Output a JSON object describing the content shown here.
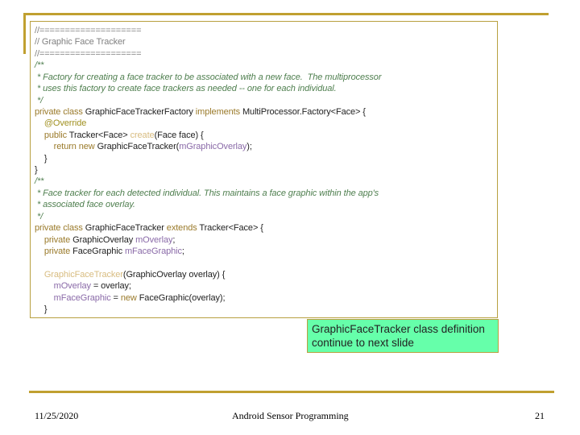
{
  "code_lines": [
    [
      [
        "c",
        "//===================="
      ]
    ],
    [
      [
        "c",
        "// Graphic Face Tracker"
      ]
    ],
    [
      [
        "c",
        "//===================="
      ]
    ],
    [
      [
        "cm",
        "/**"
      ]
    ],
    [
      [
        "cm",
        " * Factory for creating a face tracker to be associated with a new face.  The multiprocessor"
      ]
    ],
    [
      [
        "cm",
        " * uses this factory to create face trackers as needed -- one for each individual."
      ]
    ],
    [
      [
        "cm",
        " */"
      ]
    ],
    [
      [
        "k",
        "private class "
      ],
      [
        "p",
        "GraphicFaceTrackerFactory "
      ],
      [
        "k",
        "implements "
      ],
      [
        "p",
        "MultiProcessor.Factory<Face> {"
      ]
    ],
    [
      [
        "p",
        "    "
      ],
      [
        "a",
        "@Override"
      ]
    ],
    [
      [
        "p",
        "    "
      ],
      [
        "k",
        "public "
      ],
      [
        "p",
        "Tracker<Face> "
      ],
      [
        "m",
        "create"
      ],
      [
        "p",
        "(Face face) {"
      ]
    ],
    [
      [
        "p",
        "        "
      ],
      [
        "k",
        "return new "
      ],
      [
        "p",
        "GraphicFaceTracker("
      ],
      [
        "f",
        "mGraphicOverlay"
      ],
      [
        "p",
        ");"
      ]
    ],
    [
      [
        "p",
        "    }"
      ]
    ],
    [
      [
        "p",
        "}"
      ]
    ],
    [
      [
        "cm",
        "/**"
      ]
    ],
    [
      [
        "cm",
        " * Face tracker for each detected individual. This maintains a face graphic within the app's"
      ]
    ],
    [
      [
        "cm",
        " * associated face overlay."
      ]
    ],
    [
      [
        "cm",
        " */"
      ]
    ],
    [
      [
        "k",
        "private class "
      ],
      [
        "p",
        "GraphicFaceTracker "
      ],
      [
        "k",
        "extends "
      ],
      [
        "p",
        "Tracker<Face> {"
      ]
    ],
    [
      [
        "p",
        "    "
      ],
      [
        "k",
        "private "
      ],
      [
        "p",
        "GraphicOverlay "
      ],
      [
        "f",
        "mOverlay"
      ],
      [
        "p",
        ";"
      ]
    ],
    [
      [
        "p",
        "    "
      ],
      [
        "k",
        "private "
      ],
      [
        "p",
        "FaceGraphic "
      ],
      [
        "f",
        "mFaceGraphic"
      ],
      [
        "p",
        ";"
      ]
    ],
    [
      [
        "p",
        ""
      ]
    ],
    [
      [
        "p",
        "    "
      ],
      [
        "m",
        "GraphicFaceTracker"
      ],
      [
        "p",
        "(GraphicOverlay overlay) {"
      ]
    ],
    [
      [
        "p",
        "        "
      ],
      [
        "f",
        "mOverlay"
      ],
      [
        "p",
        " = overlay;"
      ]
    ],
    [
      [
        "p",
        "        "
      ],
      [
        "f",
        "mFaceGraphic"
      ],
      [
        "p",
        " = "
      ],
      [
        "k",
        "new "
      ],
      [
        "p",
        "FaceGraphic(overlay);"
      ]
    ],
    [
      [
        "p",
        "    }"
      ]
    ]
  ],
  "note": {
    "line1": "GraphicFaceTracker class definition",
    "line2": "continue to next slide"
  },
  "footer": {
    "date": "11/25/2020",
    "title": "Android Sensor Programming",
    "page": "21"
  },
  "colors": {
    "accent": "#c0a030",
    "note_bg": "#66ffaa"
  }
}
